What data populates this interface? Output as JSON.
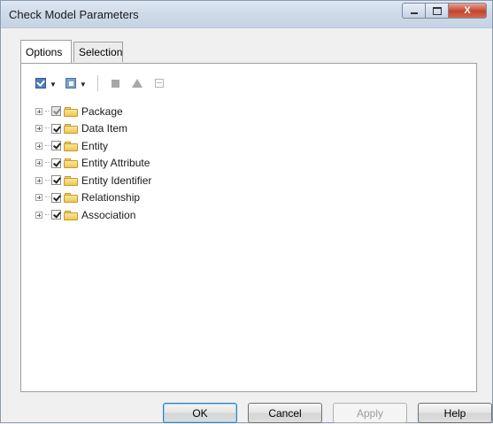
{
  "window": {
    "title": "Check Model Parameters",
    "close_glyph": "X"
  },
  "tabs": [
    {
      "label": "Options",
      "active": true
    },
    {
      "label": "Selection",
      "active": false
    }
  ],
  "toolbar": {
    "items": [
      {
        "icon": "check-all-icon",
        "has_dropdown": true
      },
      {
        "icon": "uncheck-all-icon",
        "has_dropdown": true
      },
      {
        "icon": "stop-icon",
        "enabled": false
      },
      {
        "icon": "warning-icon",
        "enabled": false
      },
      {
        "icon": "collapse-icon",
        "enabled": false
      }
    ]
  },
  "tree": {
    "items": [
      {
        "label": "Package",
        "checked": "partial"
      },
      {
        "label": "Data Item",
        "checked": true
      },
      {
        "label": "Entity",
        "checked": true
      },
      {
        "label": "Entity Attribute",
        "checked": true
      },
      {
        "label": "Entity Identifier",
        "checked": true
      },
      {
        "label": "Relationship",
        "checked": true
      },
      {
        "label": "Association",
        "checked": true
      }
    ]
  },
  "buttons": {
    "ok": "OK",
    "cancel": "Cancel",
    "apply": "Apply",
    "help": "Help"
  },
  "colors": {
    "folder": "#f0c654",
    "titlebar": "#cfdbe9",
    "close_button": "#c2452f"
  }
}
